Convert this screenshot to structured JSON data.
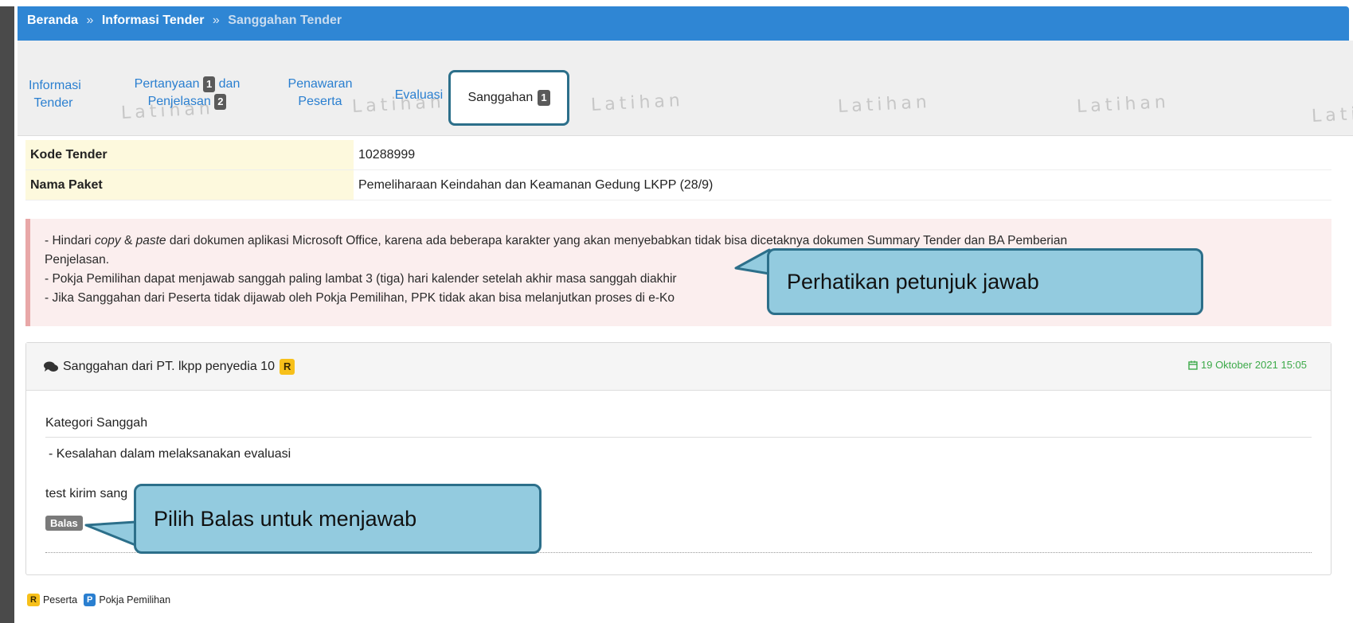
{
  "breadcrumb": {
    "home": "Beranda",
    "separator": "»",
    "tender_info": "Informasi Tender",
    "current": "Sanggahan Tender"
  },
  "watermark_text": "Latihan",
  "tabs": {
    "informasi": {
      "line1": "Informasi",
      "line2": "Tender"
    },
    "pertanyaan": {
      "line1": "Pertanyaan",
      "badge1": "1",
      "line1b": "dan",
      "line2": "Penjelasan",
      "badge2": "2"
    },
    "penawaran": {
      "line1": "Penawaran",
      "line2": "Peserta"
    },
    "evaluasi": {
      "label": "Evaluasi"
    },
    "sanggahan": {
      "label": "Sanggahan",
      "badge": "1"
    }
  },
  "info_table": {
    "kode_label": "Kode Tender",
    "kode_value": "10288999",
    "paket_label": "Nama Paket",
    "paket_value": "Pemeliharaan Keindahan dan Keamanan Gedung LKPP (28/9)"
  },
  "alert": {
    "line1_pre": "- Hindari ",
    "line1_copy": "copy",
    "line1_amp": " & ",
    "line1_paste": "paste",
    "line1_post": " dari dokumen aplikasi Microsoft Office, karena ada beberapa karakter yang akan menyebabkan tidak bisa dicetaknya dokumen Summary Tender dan BA Pemberian",
    "line1_cont": "Penjelasan.",
    "line2": "- Pokja Pemilihan dapat menjawab sanggah paling lambat 3 (tiga) hari kalender setelah akhir masa sanggah diakhir",
    "line3": "- Jika Sanggahan dari Peserta tidak dijawab oleh Pokja Pemilihan, PPK tidak akan bisa melanjutkan proses di e-Ko"
  },
  "panel": {
    "title": "Sanggahan dari PT. lkpp penyedia 10",
    "role_badge": "R",
    "date": "19 Oktober 2021 15:05",
    "kategori_label": "Kategori Sanggah",
    "kategori_item": "-  Kesalahan dalam melaksanakan evaluasi",
    "message": "test kirim sang",
    "reply_label": "Balas"
  },
  "legend": {
    "r_badge": "R",
    "r_label": "Peserta",
    "p_badge": "P",
    "p_label": "Pokja Pemilihan"
  },
  "callouts": {
    "petunjuk": "Perhatikan petunjuk jawab",
    "balas": "Pilih Balas untuk menjawab"
  },
  "colors": {
    "header_blue": "#2f86d4",
    "callout_fill": "#93cbdf",
    "callout_border": "#2c6f8a",
    "alert_bg": "#fbeeee",
    "label_bg": "#fdf9dd",
    "date_green": "#3daa4a",
    "badge_yellow": "#f7c01a"
  }
}
